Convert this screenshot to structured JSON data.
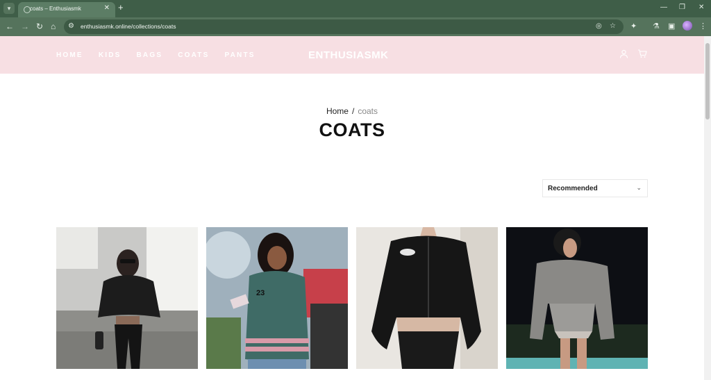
{
  "browser": {
    "tab_title": "coats – Enthusiasmk",
    "url": "enthusiasmk.online/collections/coats"
  },
  "header": {
    "nav": [
      "HOME",
      "KIDS",
      "BAGS",
      "COATS",
      "PANTS"
    ],
    "logo": "ENTHUSIASMK"
  },
  "breadcrumb": {
    "home": "Home",
    "separator": "/",
    "current": "coats"
  },
  "page_title": "COATS",
  "sort": {
    "selected": "Recommended"
  },
  "products": [
    {
      "name": "product-black-puffer-set",
      "colors": [
        "#3b3b3b",
        "#9a9a98",
        "#1a1a1a"
      ]
    },
    {
      "name": "product-green-varsity-jacket",
      "colors": [
        "#8fa3b0",
        "#3f6b66",
        "#d89aa8"
      ]
    },
    {
      "name": "product-black-leather-jacket",
      "colors": [
        "#e9e6e1",
        "#161616",
        "#d6c7b8"
      ]
    },
    {
      "name": "product-grey-structured-jacket",
      "colors": [
        "#0d0f14",
        "#8a8986",
        "#5fb3b3"
      ]
    }
  ]
}
